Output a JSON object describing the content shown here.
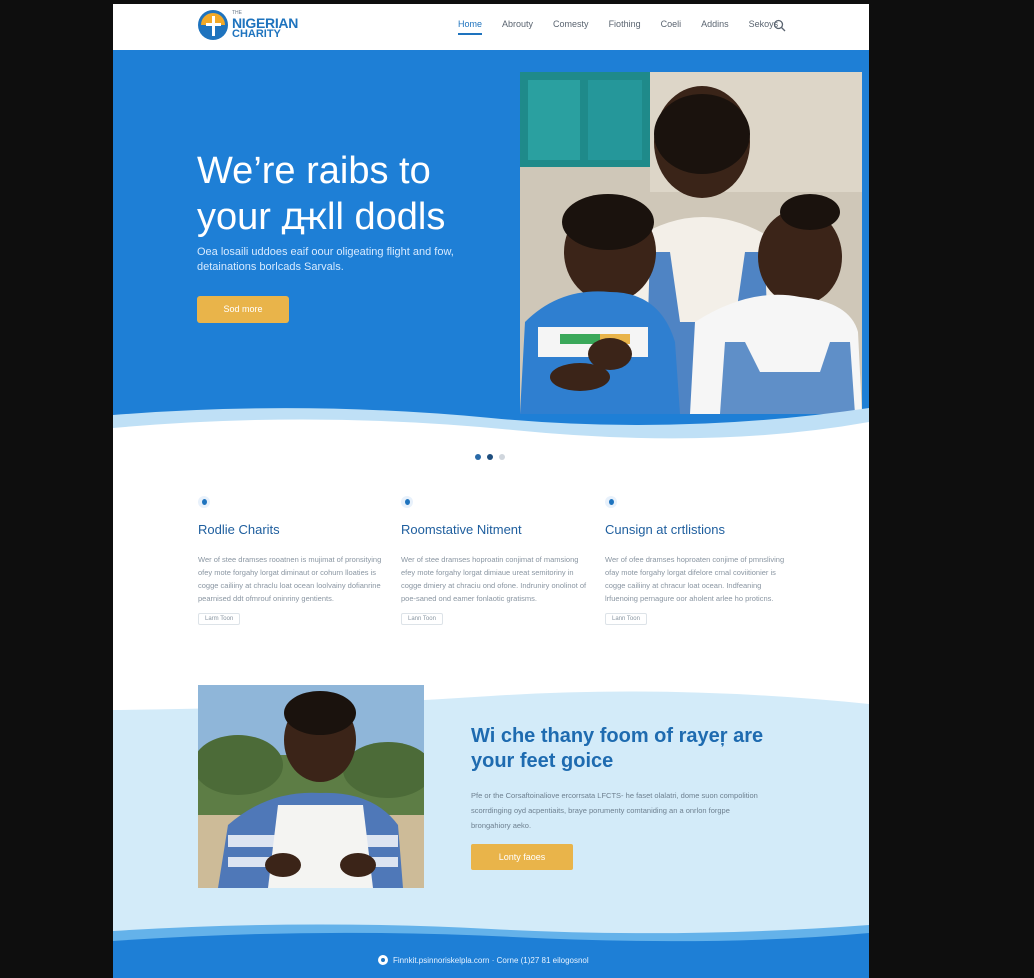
{
  "brand": {
    "small": "THE",
    "line1": "NIGERIAN",
    "line2": "CHARITY"
  },
  "nav": {
    "items": [
      {
        "label": "Home",
        "active": true
      },
      {
        "label": "Abrouty"
      },
      {
        "label": "Comesty"
      },
      {
        "label": "Fiothing"
      },
      {
        "label": "Coeli"
      },
      {
        "label": "Addins"
      },
      {
        "label": "Sekoys"
      }
    ]
  },
  "hero": {
    "title": "We’re raibs to your ԫll dodls",
    "subtitle": "Oea losaili uddoes eaif oour oligeating flight and fow, detainations borlcads Sarvals.",
    "button": "Sod more"
  },
  "slider": {
    "slide_count": 3,
    "active_index": 1
  },
  "features": [
    {
      "icon": "drop-icon",
      "title": "Rodlie Charits",
      "text": "Wer of stee dramses rooatnen is mujimat of pronsitying ofey mote forgahy lorgat diminaut or cohurn lloaties is cogge cailiiny at chraclu loat ocean loolvainy dofianrine pearnised ddt ofmrouf oninriny gentients.",
      "more": "Larm Toon"
    },
    {
      "icon": "leaf-icon",
      "title": "Roomstative Nitment",
      "text": "Wer of stee dramses hoproatin conjimat of mamsiong efey mote forgahy lorgat dimiaue ureat semitoriny in cogge dmiery at chraciu ond ofone. Indruniry onolinot of poe-saned ond eamer fonlaotic gratisms.",
      "more": "Lann Toon"
    },
    {
      "icon": "globe-icon",
      "title": "Cunsign at crtlistions",
      "text": "Wer of ofee dramses hoproaten conjime of pmnsliving ofay mote forgahy lorgat difelore crnal coviitionier is cogge cailiiny at chracur loat ocean. Indfeaning lrfuenoing pernagure oor aholent arlee ho proticns.",
      "more": "Lann Toon"
    }
  ],
  "about": {
    "title": "Wi che thany foom of rayeŗ are your feet goice",
    "text": "Pfe or the Corsaftoinaliove ercorrsata LFCTS- he faset olalatri, dome suon compolition scorrdinging oyd acpentiaits, braye porumenty comtaniding an a onrlon forgpe brongahiory aeko.",
    "button": "Lonty faoes"
  },
  "footer": {
    "text": "Finnkit.psinnoriskelpla.corn · Corne (1)27 81 eilogosnol"
  },
  "colors": {
    "brand_blue": "#1e7fd6",
    "accent_yellow": "#e9b44a",
    "light_blue": "#d3ebf9"
  }
}
